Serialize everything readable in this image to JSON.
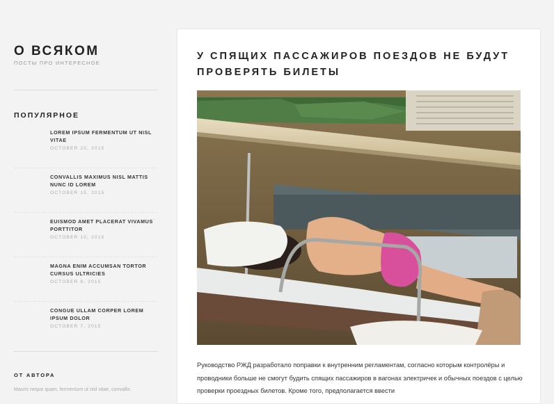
{
  "site": {
    "title": "О ВСЯКОМ",
    "description": "ПОСТЫ ПРО ИНТЕРЕСНОЕ"
  },
  "popular": {
    "title": "ПОПУЛЯРНОЕ",
    "items": [
      {
        "label": "LOREM IPSUM FERMENTUM UT NISL VITAE",
        "date": "OCTOBER 20, 2015"
      },
      {
        "label": "CONVALLIS MAXIMUS NISL MATTIS NUNC ID LOREM",
        "date": "OCTOBER 15, 2015"
      },
      {
        "label": "EUISMOD AMET PLACERAT VIVAMUS PORTTITOR",
        "date": "OCTOBER 10, 2015"
      },
      {
        "label": "MAGNA ENIM ACCUMSAN TORTOR CURSUS ULTRICIES",
        "date": "OCTOBER 8, 2015"
      },
      {
        "label": "CONGUE ULLAM CORPER LOREM IPSUM DOLOR",
        "date": "OCTOBER 7, 2015"
      }
    ]
  },
  "author": {
    "title": "ОТ АВТОРА",
    "text": "Mauris neque quam, fermentum ut nisl vitae, convallis"
  },
  "post": {
    "title": "У СПЯЩИХ ПАССАЖИРОВ ПОЕЗДОВ НЕ БУДУТ ПРОВЕРЯТЬ БИЛЕТЫ",
    "body": "Руководство РЖД разработало поправки к внутренним регламентам, согласно которым контролёры и проводники больше не смогут будить спящих пассажиров в вагонах электричек и обычных поездов с целью проверки проездных билетов. Кроме того, предполагается ввести"
  }
}
